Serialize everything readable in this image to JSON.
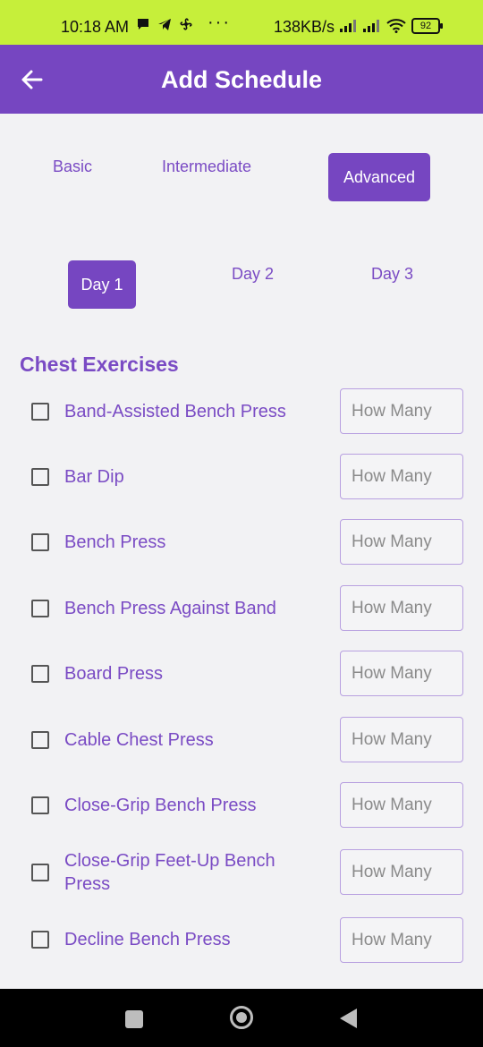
{
  "status_bar": {
    "time": "10:18 AM",
    "dots": "···",
    "speed": "138KB/s",
    "battery": "92"
  },
  "app_bar": {
    "title": "Add Schedule",
    "back_icon": "arrow-left-icon"
  },
  "levels": [
    {
      "label": "Basic",
      "active": false
    },
    {
      "label": "Intermediate",
      "active": false
    },
    {
      "label": "Advanced",
      "active": true
    }
  ],
  "days": [
    {
      "label": "Day 1",
      "active": true
    },
    {
      "label": "Day 2",
      "active": false
    },
    {
      "label": "Day 3",
      "active": false
    }
  ],
  "section_title": "Chest Exercises",
  "exercises": [
    {
      "name": "Band-Assisted Bench Press",
      "placeholder": "How Many"
    },
    {
      "name": "Bar Dip",
      "placeholder": "How Many"
    },
    {
      "name": "Bench Press",
      "placeholder": "How Many"
    },
    {
      "name": "Bench Press Against Band",
      "placeholder": "How Many"
    },
    {
      "name": "Board Press",
      "placeholder": "How Many"
    },
    {
      "name": "Cable Chest Press",
      "placeholder": "How Many"
    },
    {
      "name": "Close-Grip Bench Press",
      "placeholder": "How Many"
    },
    {
      "name": "Close-Grip Feet-Up Bench Press",
      "placeholder": "How Many"
    },
    {
      "name": "Decline Bench Press",
      "placeholder": "How Many"
    }
  ],
  "colors": {
    "status_bar": "#c6ef3a",
    "primary": "#7646c1",
    "accent_text": "#7a4bc4",
    "background": "#f2f2f4"
  }
}
